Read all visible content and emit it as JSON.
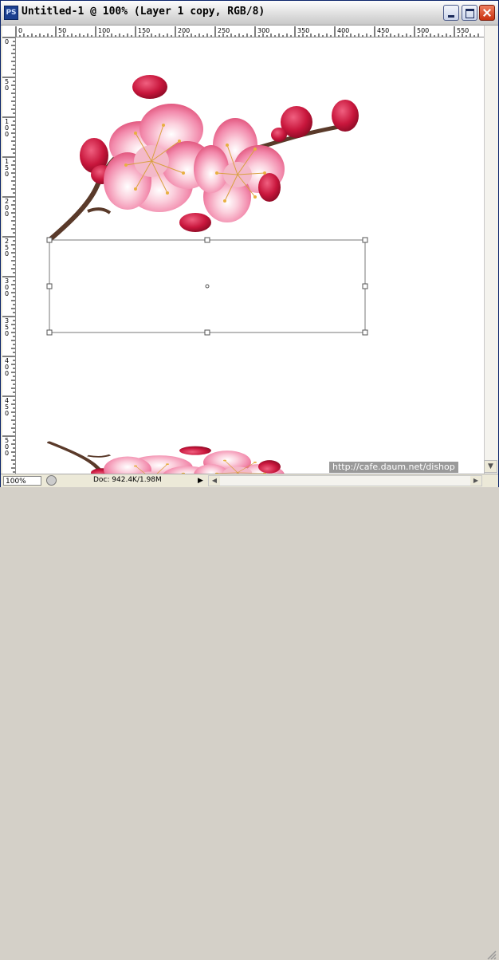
{
  "window": {
    "app_icon": "PS",
    "title": "Untitled-1 @ 100% (Layer 1 copy, RGB/8)"
  },
  "rulers": {
    "horizontal": [
      "0",
      "50",
      "100",
      "150",
      "200",
      "250",
      "300",
      "350",
      "400",
      "450",
      "500",
      "550"
    ],
    "vertical": [
      "0",
      "50",
      "100",
      "150",
      "200",
      "250",
      "300",
      "350",
      "400",
      "450",
      "500"
    ]
  },
  "status": {
    "zoom": "100%",
    "doc": "Doc: 942.4K/1.98M"
  },
  "watermark": "http://cafe.daum.net/dishop",
  "icons": {
    "app": "photoshop-icon",
    "minimize": "minimize-icon",
    "maximize": "maximize-icon",
    "close": "close-icon"
  },
  "colors": {
    "blossom_light": "#f7a8c0",
    "blossom_mid": "#e8578a",
    "bud": "#c0163a",
    "stem": "#5a3a2a"
  }
}
